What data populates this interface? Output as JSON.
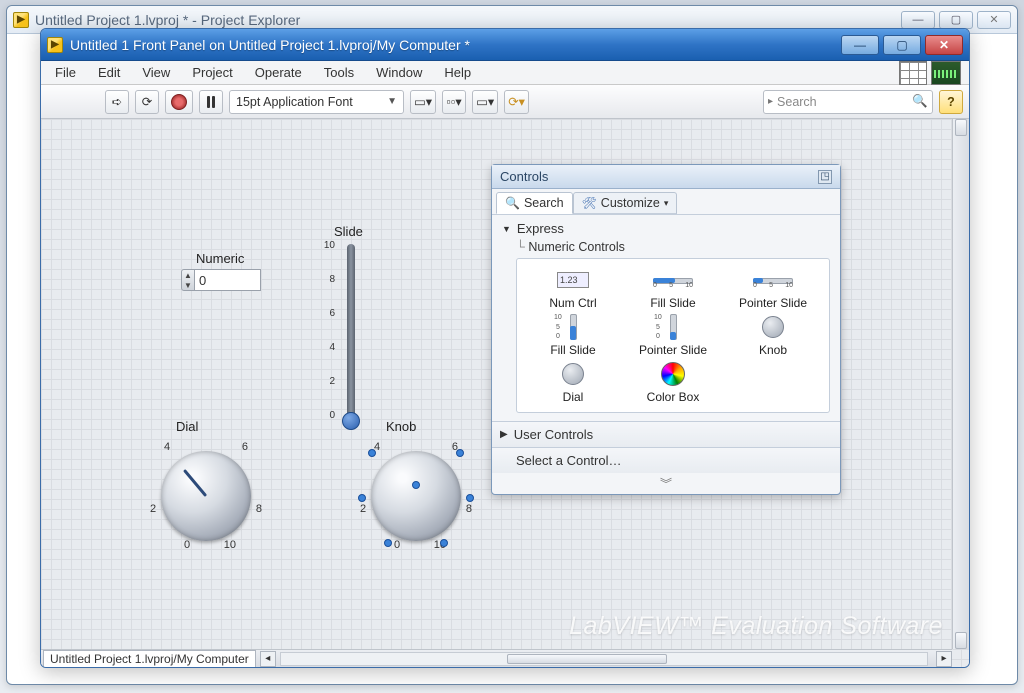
{
  "back_window": {
    "title": "Untitled Project 1.lvproj * - Project Explorer"
  },
  "front_window": {
    "title": "Untitled 1 Front Panel on Untitled Project 1.lvproj/My Computer *"
  },
  "menu": [
    "File",
    "Edit",
    "View",
    "Project",
    "Operate",
    "Tools",
    "Window",
    "Help"
  ],
  "toolbar": {
    "font": "15pt Application Font",
    "search_placeholder": "Search"
  },
  "controls": {
    "numeric": {
      "label": "Numeric",
      "value": "0"
    },
    "slide": {
      "label": "Slide",
      "ticks": [
        "10",
        "8",
        "6",
        "4",
        "2",
        "0"
      ],
      "value": 0
    },
    "dial": {
      "label": "Dial",
      "ticks": [
        "0",
        "2",
        "4",
        "6",
        "8",
        "10"
      ]
    },
    "knob": {
      "label": "Knob",
      "ticks": [
        "0",
        "2",
        "4",
        "6",
        "8",
        "10"
      ]
    }
  },
  "palette": {
    "title": "Controls",
    "tabs": {
      "search": "Search",
      "customize": "Customize"
    },
    "section": "Express",
    "subsection": "Numeric Controls",
    "items": [
      "Num Ctrl",
      "Fill Slide",
      "Pointer Slide",
      "Fill Slide",
      "Pointer Slide",
      "Knob",
      "Dial",
      "Color Box"
    ],
    "user_controls": "User Controls",
    "select_control": "Select a Control…"
  },
  "bottom_tab": "Untitled Project 1.lvproj/My Computer",
  "watermark": "LabVIEW™ Evaluation Software"
}
